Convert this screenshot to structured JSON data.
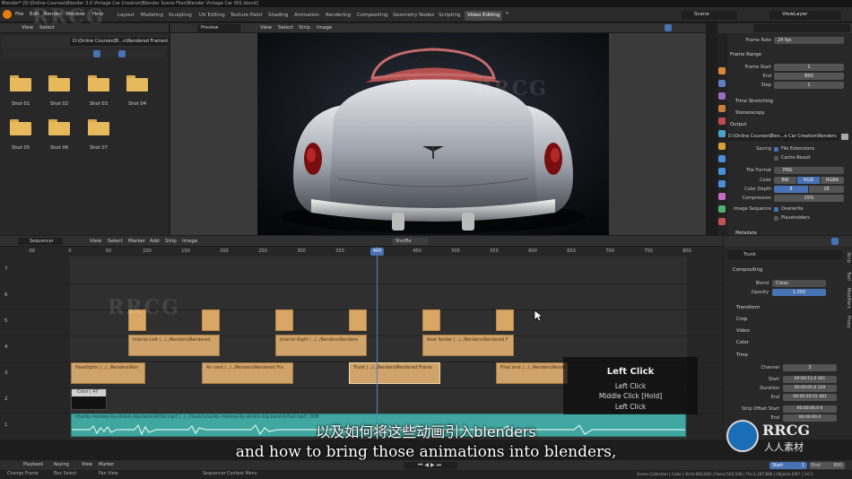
{
  "window_title": "Blender* [D:\\Online Courses\\Blender 3.0 Vintage Car Creation\\Blender Scene Files\\Blender Vintage Car 001.blend]",
  "menu": [
    "File",
    "Edit",
    "Render",
    "Window",
    "Help"
  ],
  "workspaces": [
    "Layout",
    "Modeling",
    "Sculpting",
    "UV Editing",
    "Texture Paint",
    "Shading",
    "Animation",
    "Rendering",
    "Compositing",
    "Geometry Nodes",
    "Scripting",
    "Video Editing"
  ],
  "active_workspace": "Video Editing",
  "scene_label": "Scene",
  "viewlayer_label": "ViewLayer",
  "file_browser": {
    "header_items": [
      "View",
      "Select"
    ],
    "path": "D:\\Online Courses\\Bl...n\\Rendered Frames\\",
    "folders": [
      "Shot 01",
      "Shot 02",
      "Shot 03",
      "Shot 04",
      "Shot 05",
      "Shot 06",
      "Shot 07"
    ]
  },
  "preview": {
    "mode": "Preview",
    "header_items": [
      "View",
      "Select",
      "Strip",
      "Image"
    ]
  },
  "properties": {
    "frame_rate_label": "Frame Rate",
    "frame_rate_value": "24 fps",
    "frame_range_title": "Frame Range",
    "frame_start_label": "Frame Start",
    "frame_start": "1",
    "end_label": "End",
    "end": "800",
    "step_label": "Step",
    "step": "1",
    "time_stretching": "Time Stretching",
    "stereoscopy": "Stereoscopy",
    "output_title": "Output",
    "output_path": "D:\\Online Courses\\Blen...e Car Creation\\Renders",
    "saving_label": "Saving",
    "file_extensions": "File Extensions",
    "cache_result": "Cache Result",
    "file_format_label": "File Format",
    "file_format": "PNG",
    "color_label": "Color",
    "color_options": [
      "BW",
      "RGB",
      "RGBA"
    ],
    "color_depth_label": "Color Depth",
    "color_depth": [
      "8",
      "16"
    ],
    "compression_label": "Compression",
    "compression": "15%",
    "image_sequence_label": "Image Sequence",
    "overwrite": "Overwrite",
    "placeholders": "Placeholders",
    "metadata": "Metadata"
  },
  "sequencer": {
    "editor_label": "Sequencer",
    "header_items": [
      "View",
      "Select",
      "Marker",
      "Add",
      "Strip",
      "Image"
    ],
    "shuffle": "Shuffle",
    "ruler_ticks": [
      "-50",
      "0",
      "50",
      "100",
      "150",
      "200",
      "250",
      "300",
      "350",
      "400",
      "450",
      "500",
      "550",
      "600",
      "650",
      "700",
      "750",
      "800"
    ],
    "current_frame": "400",
    "channels": [
      "7",
      "6",
      "5",
      "4",
      "3",
      "2",
      "1"
    ],
    "strips": {
      "ch4": [
        "Interior Left | ../../Renders\\Rendered",
        "Interior Right | ../../Renders\\Rendere",
        "Rear fender | ../../Renders\\Rendered F"
      ],
      "ch3": [
        "Headlights | ../../Renders\\Ren",
        "Air vent | ../../Renders\\Rendered Fra",
        "Trunk | ../../Renders\\Rendered Frame",
        "Final shot | ../../Renders\\Rende"
      ],
      "color_strip": "Color | 47",
      "audio": "chunky-monkey-by-stinkin-big-band.Artlist.mp3 | ../../music\\chunky-monkey-by-stinkin-big-band.Artlist.mp3 | 808"
    }
  },
  "key_overlay": [
    "Left Click",
    "Left Click",
    "Middle Click [Hold]",
    "Left Click"
  ],
  "strip_sidebar": {
    "title": "Trunk",
    "compositing": "Compositing",
    "blend_label": "Blend",
    "blend": "Cross",
    "opacity_label": "Opacity",
    "opacity": "1.000",
    "transform": "Transform",
    "crop": "Crop",
    "video": "Video",
    "color": "Color",
    "time": "Time",
    "channel_label": "Channel",
    "channel": "3",
    "start_label": "Start",
    "start": "00:00:15.0  361",
    "duration_label": "Duration",
    "duration": "00:00:05.0  120",
    "end_label": "End",
    "end": "00:00:20.01  481",
    "strip_offset_label": "Strip Offset Start",
    "strip_offset": "00:00:00.0  0",
    "end2_label": "End",
    "end2": "00:00:00.0",
    "tabs": [
      "Strip",
      "Tool",
      "Modifiers",
      "Proxy"
    ]
  },
  "timeline": {
    "items": [
      "Playback",
      "Keying",
      "View",
      "Marker"
    ],
    "start_label": "Start",
    "start": "1",
    "end_label": "End",
    "end": "800"
  },
  "status_bar": {
    "left": [
      "Change Frame",
      "Box Select",
      "Pan View"
    ],
    "center": "Sequencer Context Menu",
    "right": "Scene Collection | Cube | Verts:603,840 | Faces:593,548 | Tris:1,187,880 | Objects:0/87 | 3.0.1"
  },
  "subtitles": {
    "zh": "以及如何将这些动画引入blenders",
    "en": "and how to bring those animations into blenders,"
  },
  "watermark": "RRCG",
  "logo_text": "人人素材",
  "colors": {
    "accent_blue": "#4772b3",
    "strip_image": "#cfa36a",
    "strip_audio": "#3fa7a0",
    "playhead": "#5680c2"
  }
}
